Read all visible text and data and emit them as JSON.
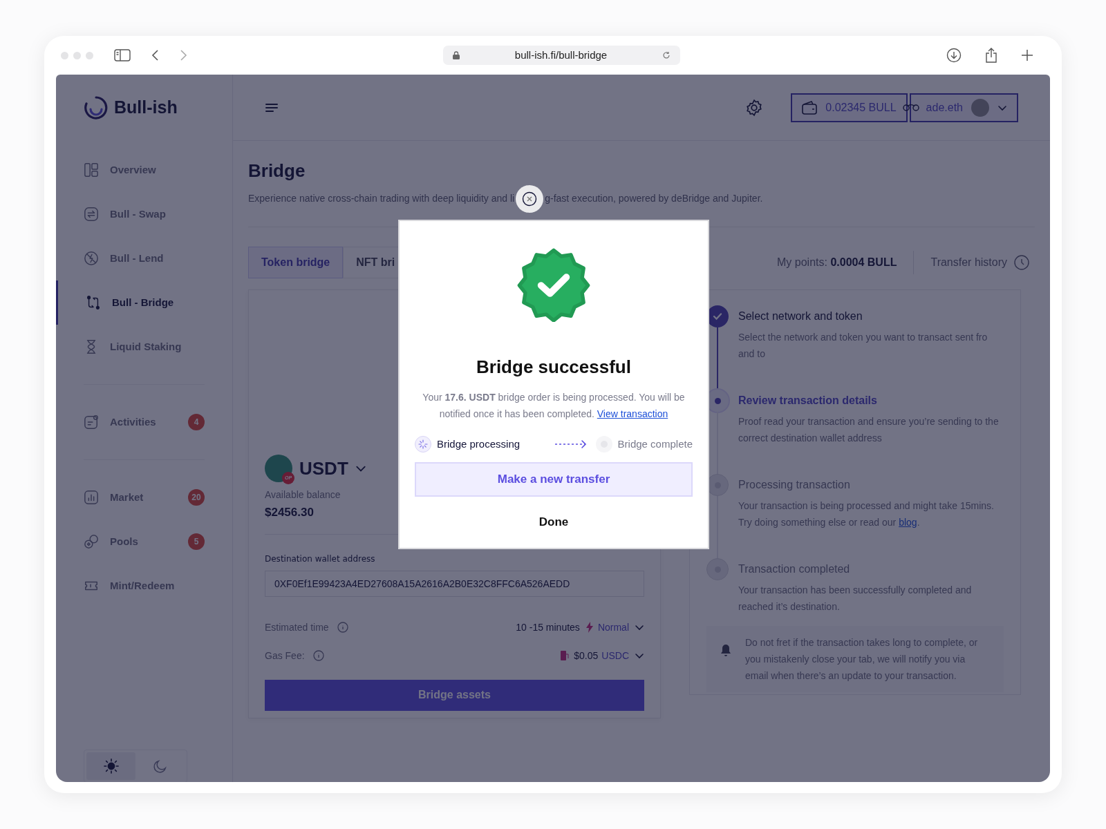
{
  "browser": {
    "url": "bull-ish.fi/bull-bridge"
  },
  "sidebar": {
    "logo": "Bull-ish",
    "groups": [
      [
        {
          "label": "Overview",
          "selected": false
        },
        {
          "label": "Bull - Swap",
          "selected": false
        },
        {
          "label": "Bull - Lend",
          "selected": false
        },
        {
          "label": "Bull - Bridge",
          "selected": true
        },
        {
          "label": "Liquid Staking",
          "selected": false
        }
      ],
      [
        {
          "label": "Activities",
          "badge": "4",
          "selected": false
        }
      ],
      [
        {
          "label": "Market",
          "badge": "20",
          "selected": false
        },
        {
          "label": "Pools",
          "badge": "5",
          "selected": false
        },
        {
          "label": "Mint/Redeem",
          "selected": false
        }
      ]
    ],
    "theme": [
      {
        "kind": "light",
        "selected": true
      },
      {
        "kind": "dark",
        "selected": false
      }
    ]
  },
  "header": {
    "balance": "0.02345 BULL",
    "account": "ade.eth"
  },
  "page": {
    "title": "Bridge",
    "description_before": "Experience native cross-chain trading with deep liquidity and li",
    "description_after": "g-fast execution, powered by deBridge and Jupiter.",
    "tabs": [
      {
        "label": "Token bridge",
        "selected": true
      },
      {
        "label": "NFT bri",
        "selected": false
      }
    ],
    "points_label": "My points:",
    "points_value": "0.0004 BULL",
    "transfer_history": "Transfer history"
  },
  "form": {
    "token": "USDT",
    "chain_badge": "OP",
    "balance_label": "Available balance",
    "balance": "$2456.30",
    "address_label": "Destination wallet address",
    "address": "0XF0Ef1E99423A4ED27608A15A2616A2B0E32C8FFC6A526AEDD",
    "estimated_time_label": "Estimated time",
    "estimated_time": "10 -15 minutes",
    "speed": "Normal",
    "gas_label": "Gas Fee:",
    "gas_value": "$0.05",
    "gas_token": "USDC",
    "submit": "Bridge assets"
  },
  "steps": [
    {
      "title": "Select network and token",
      "description": "Select the network and token you want to transact sent fro and to",
      "done": true,
      "active": false
    },
    {
      "title": "Review transaction details",
      "description": "Proof read your transaction and ensure you’re sending to the correct destination wallet address",
      "done": false,
      "active": true
    },
    {
      "title": "Processing transaction",
      "description": "Your transaction is being processed and might take 15mins. Try doing something else or read our ",
      "link": "blog",
      "description_end": ".",
      "done": false,
      "active": false
    },
    {
      "title": "Transaction completed",
      "description": "Your transaction has been successfully completed and reached it’s destination.",
      "done": false,
      "active": false
    }
  ],
  "notice": "Do not fret if the transaction takes long to complete, or you mistakenly close your tab, we will notify you via email when there’s an update to your transaction.",
  "modal": {
    "title": "Bridge successful",
    "message": "Your **17.6. USDT** bridge order is being processed. You will be notified once it has been completed.",
    "link": "View transaction",
    "progress": [
      {
        "label": "Bridge processing",
        "active": true
      },
      {
        "label": "Bridge complete",
        "active": false
      }
    ],
    "primary": "Make a new transfer",
    "secondary": "Done"
  }
}
